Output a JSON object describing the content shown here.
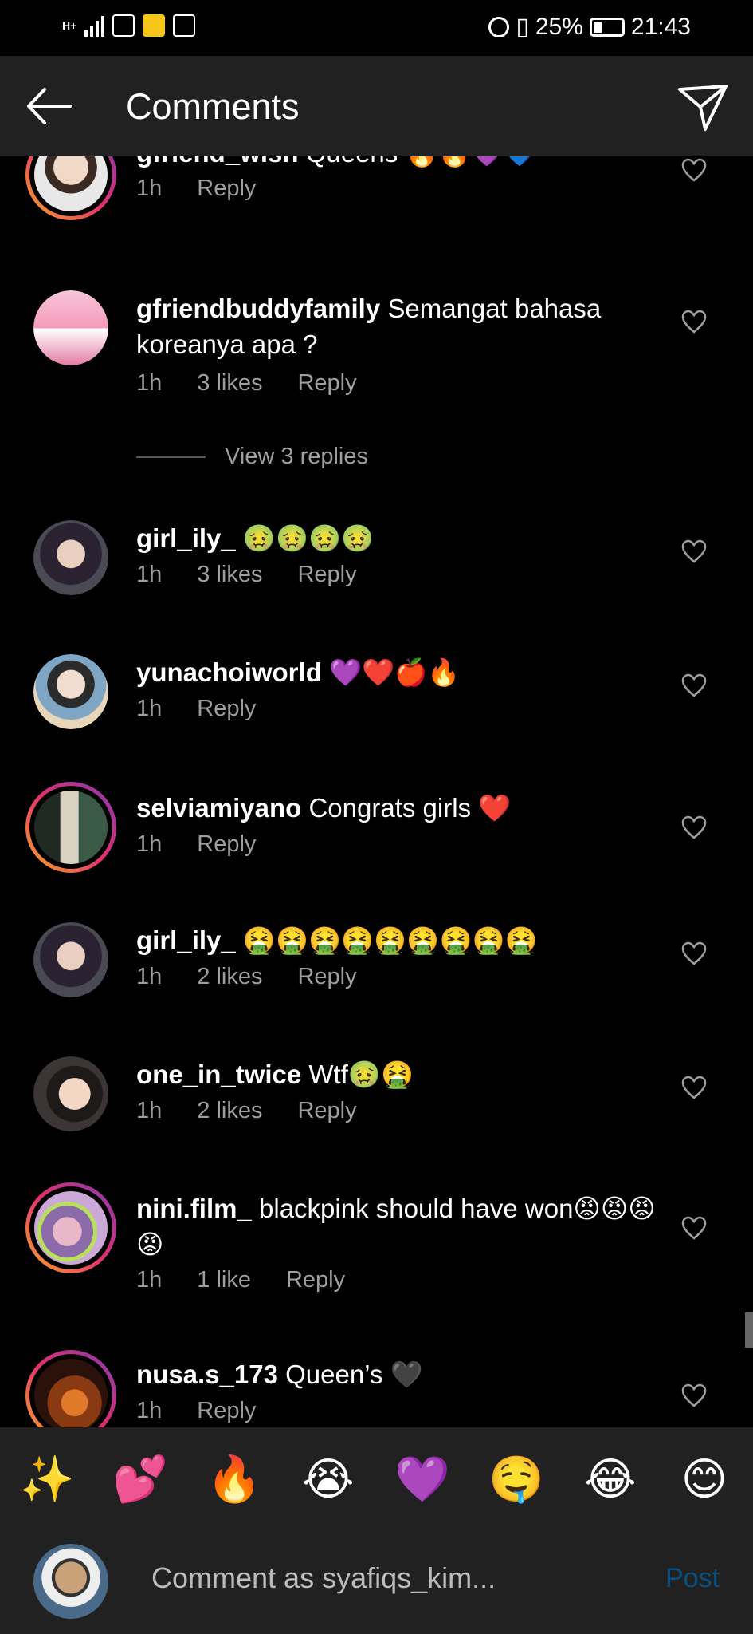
{
  "status_bar": {
    "network": "H+",
    "battery": "25%",
    "time": "21:43"
  },
  "header": {
    "title": "Comments"
  },
  "comments": [
    {
      "username": "gfriend_wish",
      "text": "Queens 🔥🔥💜💙",
      "time": "1h",
      "likes": "",
      "reply": "Reply"
    },
    {
      "username": "gfriendbuddyfamily",
      "text": "Semangat bahasa koreanya apa ?",
      "time": "1h",
      "likes": "3 likes",
      "reply": "Reply",
      "view_replies": "View 3 replies"
    },
    {
      "username": "girl_ily_",
      "text": "🤢🤢🤢🤢",
      "time": "1h",
      "likes": "3 likes",
      "reply": "Reply"
    },
    {
      "username": "yunachoiworld",
      "text": "💜❤️🍎🔥",
      "time": "1h",
      "likes": "",
      "reply": "Reply"
    },
    {
      "username": "selviamiyano",
      "text": "Congrats girls ❤️",
      "time": "1h",
      "likes": "",
      "reply": "Reply"
    },
    {
      "username": "girl_ily_",
      "text": "🤮🤮🤮🤮🤮🤮🤮🤮🤮",
      "time": "1h",
      "likes": "2 likes",
      "reply": "Reply"
    },
    {
      "username": "one_in_twice",
      "text": "Wtf🤢🤮",
      "time": "1h",
      "likes": "2 likes",
      "reply": "Reply"
    },
    {
      "username": "nini.film_",
      "text": "blackpink should have won😡😡😡😡",
      "time": "1h",
      "likes": "1 like",
      "reply": "Reply"
    },
    {
      "username": "nusa.s_173",
      "text": "Queen’s 🖤",
      "time": "1h",
      "likes": "",
      "reply": "Reply"
    }
  ],
  "emoji_bar": [
    "✨",
    "💕",
    "🔥",
    "😭",
    "💜",
    "🤤",
    "😂",
    "😊"
  ],
  "composer": {
    "placeholder": "Comment as syafiqs_kim...",
    "post_label": "Post"
  },
  "colors": {
    "background": "#000000",
    "header_bg": "#212121",
    "meta_text": "#9e9e9e",
    "post_disabled": "#0a4f80"
  }
}
